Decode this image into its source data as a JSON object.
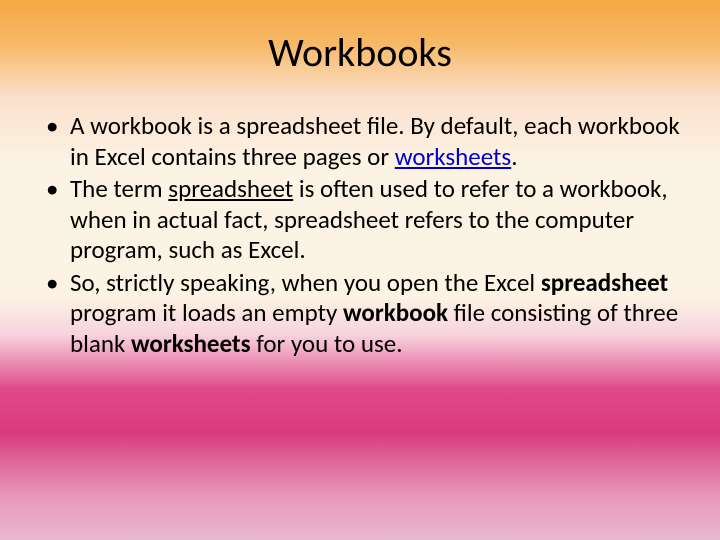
{
  "slide": {
    "title": "Workbooks",
    "bullets": [
      {
        "pre": "A workbook is a spreadsheet file. By default, each workbook in Excel contains three pages or ",
        "link": "worksheets",
        "post": "."
      },
      {
        "pre": "The term ",
        "uline": "spreadsheet",
        "post": " is often used to refer to a workbook, when in actual fact, spreadsheet refers to the computer program, such as Excel."
      },
      {
        "pre": "So, strictly speaking, when you open the Excel ",
        "b1": "spreadsheet",
        "mid1": " program it loads an empty ",
        "b2": "workbook",
        "mid2": " file consisting of three blank ",
        "b3": "worksheets",
        "post": " for you to use."
      }
    ]
  }
}
